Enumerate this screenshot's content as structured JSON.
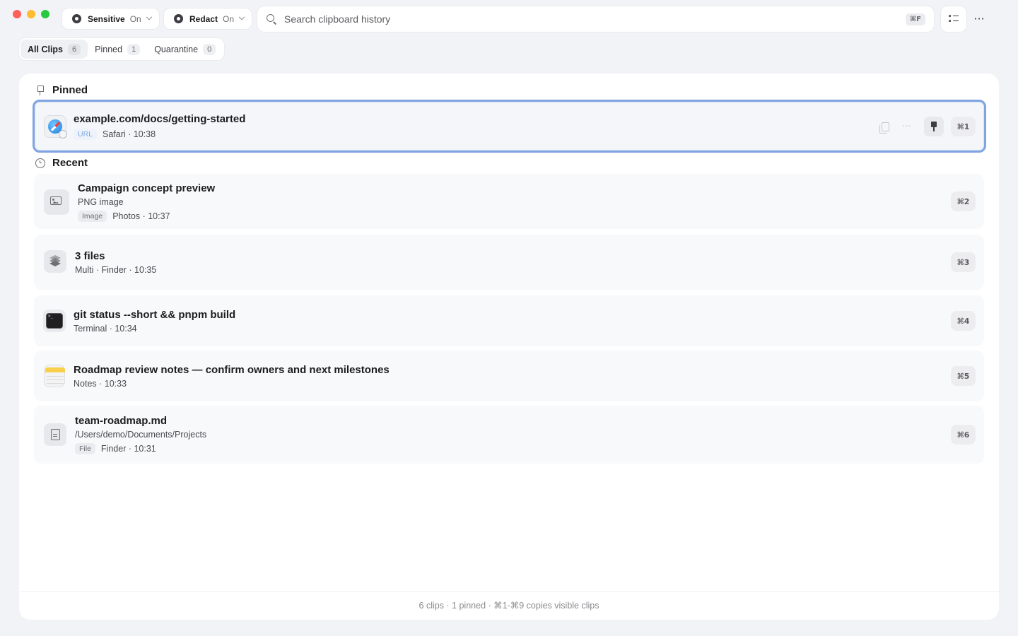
{
  "toolbar": {
    "sensitive": {
      "label": "Sensitive",
      "state": "On"
    },
    "redact": {
      "label": "Redact",
      "state": "On"
    },
    "search": {
      "placeholder": "Search clipboard history",
      "shortcut": "⌘F"
    }
  },
  "tabs": [
    {
      "label": "All Clips",
      "count": "6",
      "active": true
    },
    {
      "label": "Pinned",
      "count": "1",
      "active": false
    },
    {
      "label": "Quarantine",
      "count": "0",
      "active": false
    }
  ],
  "sections": {
    "pinned": "Pinned",
    "recent": "Recent"
  },
  "pinned_clip": {
    "title": "example.com/docs/getting-started",
    "tag": "URL",
    "meta": "Safari · 10:38",
    "shortcut": "⌘1",
    "icon": "safari-icon"
  },
  "recent_clips": [
    {
      "title": "Campaign concept preview",
      "subtitle": "PNG image",
      "tag": "Image",
      "meta": "Photos · 10:37",
      "shortcut": "⌘2",
      "icon": "image-icon"
    },
    {
      "title": "3 files",
      "meta": "Multi · Finder · 10:35",
      "shortcut": "⌘3",
      "icon": "stack-icon"
    },
    {
      "title": "git status --short && pnpm build",
      "meta": "Terminal · 10:34",
      "shortcut": "⌘4",
      "icon": "terminal-icon"
    },
    {
      "title": "Roadmap review notes — confirm owners and next milestones",
      "meta": "Notes · 10:33",
      "shortcut": "⌘5",
      "icon": "notes-icon"
    },
    {
      "title": "team-roadmap.md",
      "subtitle": "/Users/demo/Documents/Projects",
      "tag": "File",
      "meta": "Finder · 10:31",
      "shortcut": "⌘6",
      "icon": "document-icon"
    }
  ],
  "footer": "6 clips · 1 pinned · ⌘1-⌘9 copies visible clips",
  "colors": {
    "selection_border": "#7fa4e0",
    "url_tag": "#79a7e8",
    "close": "#fe5f57",
    "minimize": "#febc2e",
    "zoom": "#28c840"
  }
}
